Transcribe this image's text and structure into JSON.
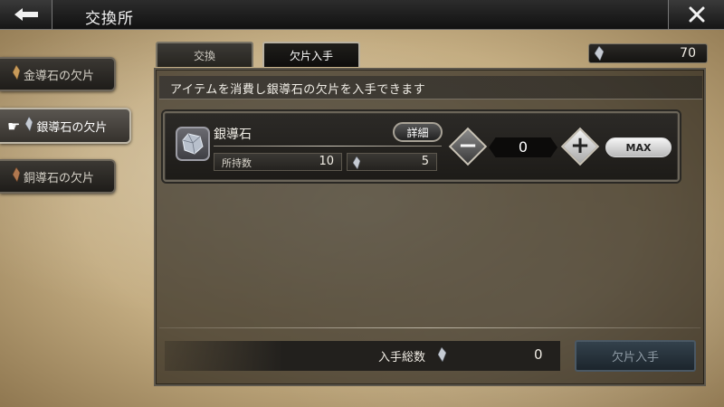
{
  "header": {
    "title": "交換所",
    "back_icon": "arrow-left-icon",
    "close_icon": "close-icon"
  },
  "sidebar": {
    "items": [
      {
        "label": "金導石の欠片",
        "active": false
      },
      {
        "label": "銀導石の欠片",
        "active": true
      },
      {
        "label": "銅導石の欠片",
        "active": false
      }
    ]
  },
  "tabs": [
    {
      "label": "交換",
      "active": false
    },
    {
      "label": "欠片入手",
      "active": true
    }
  ],
  "currency": {
    "value": "70",
    "icon": "shard-icon"
  },
  "description": "アイテムを消費し銀導石の欠片を入手できます",
  "item": {
    "name": "銀導石",
    "detail_label": "詳細",
    "owned_label": "所持数",
    "owned_value": "10",
    "shard_value": "5",
    "quantity": "0",
    "max_label": "MAX",
    "minus_symbol": "−",
    "plus_symbol": "+"
  },
  "footer": {
    "total_label": "入手総数",
    "total_value": "0",
    "acquire_label": "欠片入手"
  },
  "colors": {
    "parchment": "#c4ad82",
    "panel": "#1d1b18",
    "accent_button_disabled": "#33414c"
  }
}
